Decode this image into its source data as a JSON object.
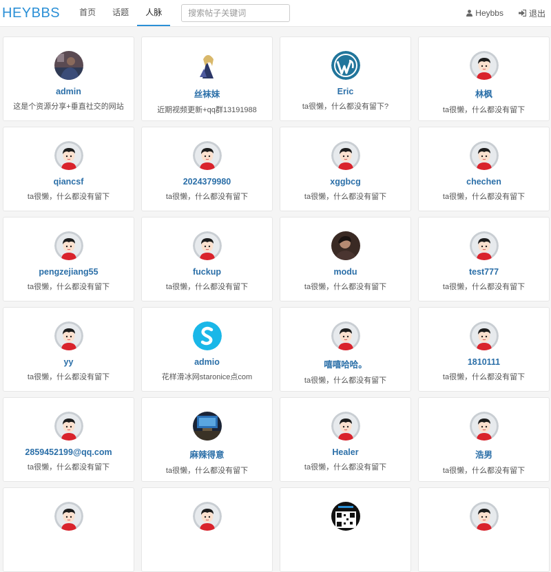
{
  "brand": "HEYBBS",
  "nav": {
    "home": "首页",
    "topics": "话题",
    "people": "人脉"
  },
  "search": {
    "placeholder": "搜索帖子关键词"
  },
  "user": {
    "name": "Heybbs",
    "logout": "退出"
  },
  "colors": {
    "accent": "#2a8fd6",
    "link": "#2b6fa8"
  },
  "users": [
    {
      "name": "admin",
      "bio": "这是个资源分享+垂直社交的网站",
      "avatar": "photo-icon"
    },
    {
      "name": "丝袜妹",
      "bio": "近期视频更新+qq群13191988",
      "avatar": "anime-icon"
    },
    {
      "name": "Eric",
      "bio": "ta很懒，什么都没有留下?",
      "avatar": "wordpress-icon"
    },
    {
      "name": "林枫",
      "bio": "ta很懒，什么都没有留下",
      "avatar": "default-avatar-icon"
    },
    {
      "name": "qiancsf",
      "bio": "ta很懒，什么都没有留下",
      "avatar": "default-avatar-icon"
    },
    {
      "name": "2024379980",
      "bio": "ta很懒，什么都没有留下",
      "avatar": "default-avatar-icon"
    },
    {
      "name": "xggbcg",
      "bio": "ta很懒，什么都没有留下",
      "avatar": "default-avatar-icon"
    },
    {
      "name": "chechen",
      "bio": "ta很懒，什么都没有留下",
      "avatar": "default-avatar-icon"
    },
    {
      "name": "pengzejiang55",
      "bio": "ta很懒，什么都没有留下",
      "avatar": "default-avatar-icon"
    },
    {
      "name": "fuckup",
      "bio": "ta很懒，什么都没有留下",
      "avatar": "default-avatar-icon"
    },
    {
      "name": "modu",
      "bio": "ta很懒，什么都没有留下",
      "avatar": "portrait-icon"
    },
    {
      "name": "test777",
      "bio": "ta很懒，什么都没有留下",
      "avatar": "default-avatar-icon"
    },
    {
      "name": "yy",
      "bio": "ta很懒，什么都没有留下",
      "avatar": "default-avatar-icon"
    },
    {
      "name": "admio",
      "bio": "花样滑冰网staronice点com",
      "avatar": "s-logo-icon"
    },
    {
      "name": "嘻嘻哈哈。",
      "bio": "ta很懒，什么都没有留下",
      "avatar": "default-avatar-icon"
    },
    {
      "name": "1810111",
      "bio": "ta很懒，什么都没有留下",
      "avatar": "default-avatar-icon"
    },
    {
      "name": "2859452199@qq.com",
      "bio": "ta很懒，什么都没有留下",
      "avatar": "default-avatar-icon"
    },
    {
      "name": "麻辣得意",
      "bio": "ta很懒，什么都没有留下",
      "avatar": "desk-photo-icon"
    },
    {
      "name": "Healer",
      "bio": "ta很懒，什么都没有留下",
      "avatar": "default-avatar-icon"
    },
    {
      "name": "浩男",
      "bio": "ta很懒，什么都没有留下",
      "avatar": "default-avatar-icon"
    },
    {
      "name": "",
      "bio": "",
      "avatar": "default-avatar-icon"
    },
    {
      "name": "",
      "bio": "",
      "avatar": "default-avatar-icon"
    },
    {
      "name": "",
      "bio": "",
      "avatar": "qr-code-icon"
    },
    {
      "name": "",
      "bio": "",
      "avatar": "default-avatar-icon"
    }
  ]
}
